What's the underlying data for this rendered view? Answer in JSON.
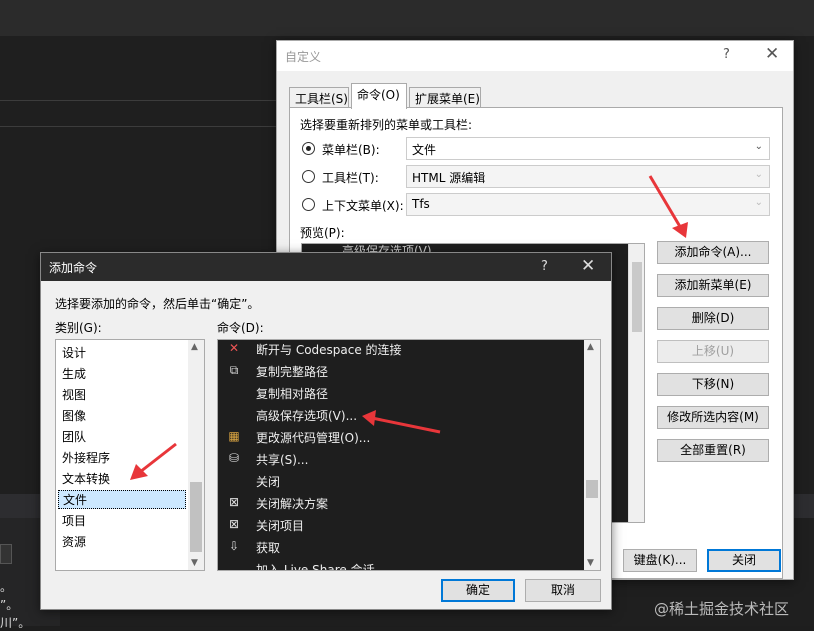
{
  "background_ide": {
    "bottom_text_lines": [
      "。",
      "”。",
      "川”。"
    ]
  },
  "customize_dialog": {
    "title": "自定义",
    "help_glyph": "?",
    "close_glyph": "✕",
    "tabs": [
      {
        "label": "工具栏(S)"
      },
      {
        "label": "命令(O)"
      },
      {
        "label": "扩展菜单(E)"
      }
    ],
    "instruction": "选择要重新排列的菜单或工具栏:",
    "options": [
      {
        "label": "菜单栏(B):",
        "value": "文件",
        "checked": true,
        "enabled": true
      },
      {
        "label": "工具栏(T):",
        "value": "HTML 源编辑",
        "checked": false,
        "enabled": false
      },
      {
        "label": "上下文菜单(X):",
        "value": "Tfs",
        "checked": false,
        "enabled": false
      }
    ],
    "preview_label": "预览(P):",
    "preview_partial_text": "高级保存选项(V)...",
    "buttons": {
      "add_command": "添加命令(A)...",
      "add_menu": "添加新菜单(E)",
      "delete": "删除(D)",
      "move_up": "上移(U)",
      "move_down": "下移(N)",
      "modify_selection": "修改所选内容(M)",
      "reset_all": "全部重置(R)",
      "keyboard": "键盘(K)...",
      "close": "关闭"
    }
  },
  "add_command_dialog": {
    "title": "添加命令",
    "help_glyph": "?",
    "close_glyph": "✕",
    "instruction": "选择要添加的命令，然后单击“确定”。",
    "categories_label": "类别(G):",
    "commands_label": "命令(D):",
    "categories": [
      "设计",
      "生成",
      "视图",
      "图像",
      "团队",
      "外接程序",
      "文本转换",
      "文件",
      "项目",
      "资源"
    ],
    "selected_category": "文件",
    "commands": [
      {
        "label": "断开与 Codespace 的连接",
        "icon": "disconnect-icon"
      },
      {
        "label": "复制完整路径",
        "icon": "copy-icon"
      },
      {
        "label": "复制相对路径",
        "icon": ""
      },
      {
        "label": "高级保存选项(V)...",
        "icon": ""
      },
      {
        "label": "更改源代码管理(O)...",
        "icon": "source-control-icon"
      },
      {
        "label": "共享(S)...",
        "icon": "share-icon"
      },
      {
        "label": "关闭",
        "icon": ""
      },
      {
        "label": "关闭解决方案",
        "icon": "close-solution-icon"
      },
      {
        "label": "关闭项目",
        "icon": "close-project-icon"
      },
      {
        "label": "获取",
        "icon": "get-icon"
      },
      {
        "label": "加入 Live Share 会话",
        "icon": ""
      }
    ],
    "ok_label": "确定",
    "cancel_label": "取消"
  },
  "watermark": "@稀土掘金技术社区",
  "colors": {
    "annotation_arrow": "#e8363a",
    "selection": "#cce8ff",
    "primary_border": "#0078d7"
  }
}
